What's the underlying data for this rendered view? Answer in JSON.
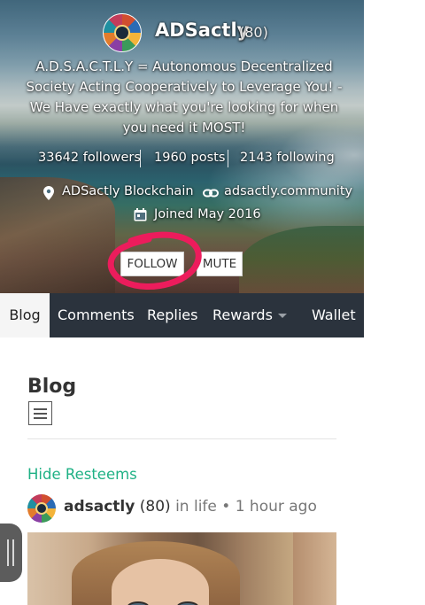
{
  "profile": {
    "username": "ADSactly",
    "reputation": "(80)",
    "about": "A.D.S.A.C.T.L.Y = Autonomous Decentralized Society Acting Cooperatively to Leverage You! - We Have exactly what you're looking for when you need it MOST!",
    "followers": "33642 followers",
    "posts": "1960 posts",
    "following": "2143 following",
    "location": "ADSactly Blockchain",
    "website": "adsactly.community",
    "joined": "Joined May 2016",
    "follow_label": "FOLLOW",
    "mute_label": "MUTE"
  },
  "tabs": [
    {
      "label": "Blog",
      "active": true
    },
    {
      "label": "Comments"
    },
    {
      "label": "Replies"
    },
    {
      "label": "Rewards",
      "has_dropdown": true
    },
    {
      "label": "Wallet"
    }
  ],
  "content": {
    "section_title": "Blog",
    "hide_resteems": "Hide Resteems"
  },
  "post": {
    "author": "adsactly",
    "reputation": "(80)",
    "in_label": "in",
    "category": "life",
    "separator": "•",
    "time": "1 hour ago"
  },
  "colors": {
    "tabbar_bg": "#2b333d",
    "link_green": "#1fb185",
    "annotation_red": "#ec1c5c"
  },
  "icons": [
    "location-pin-icon",
    "link-icon",
    "calendar-icon",
    "list-view-icon",
    "caret-down-icon"
  ]
}
